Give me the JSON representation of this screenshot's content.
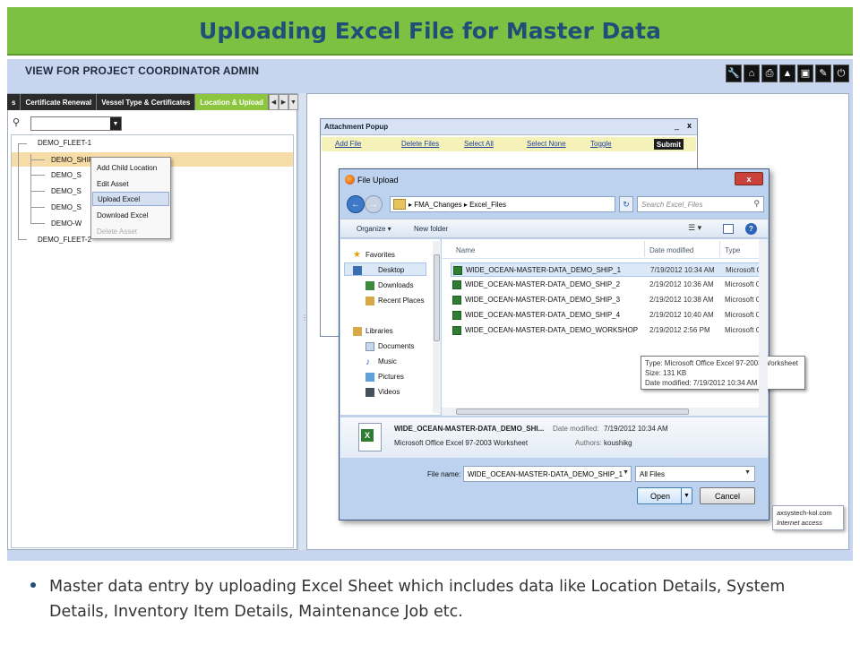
{
  "slide": {
    "title": "Uploading Excel File for Master Data",
    "bullet": "Master data entry by uploading Excel Sheet which includes data like Location Details, System Details, Inventory Item Details, Maintenance Job etc."
  },
  "app": {
    "view_title": "VIEW FOR PROJECT COORDINATOR ADMIN",
    "toolbar_icons": [
      "wrench-icon",
      "home-icon",
      "print-icon",
      "warning-icon",
      "document-icon",
      "pencil-icon",
      "power-icon"
    ],
    "tabs": [
      {
        "label": "s"
      },
      {
        "label": "Certificate Renewal"
      },
      {
        "label": "Vessel Type & Certificates"
      },
      {
        "label": "Location & Upload",
        "active": true
      }
    ],
    "tree": {
      "nodes": [
        "DEMO_FLEET-1",
        "DEMO_SHIP_1",
        "DEMO_S",
        "DEMO_S",
        "DEMO_S",
        "DEMO-W",
        "DEMO_FLEET-2"
      ]
    },
    "context_menu": {
      "items": [
        {
          "label": "Add Child Location"
        },
        {
          "label": "Edit Asset"
        },
        {
          "label": "Upload Excel",
          "hover": true
        },
        {
          "label": "Download Excel"
        },
        {
          "label": "Delete Asset",
          "disabled": true
        }
      ]
    },
    "attachment_popup": {
      "title": "Attachment Popup",
      "links": [
        "Add File",
        "Delete Files",
        "Select All",
        "Select None",
        "Toggle"
      ],
      "submit": "Submit",
      "minimize": "_",
      "close": "x"
    },
    "file_dialog": {
      "title": "File Upload",
      "close": "x",
      "path_parts": [
        "FMA_Changes",
        "Excel_Files"
      ],
      "path_separator": "▸",
      "search_placeholder": "Search Excel_Files",
      "organize": "Organize ▾",
      "new_folder": "New folder",
      "nav": {
        "favorites": "Favorites",
        "desktop": "Desktop",
        "downloads": "Downloads",
        "recent": "Recent Places",
        "libraries": "Libraries",
        "documents": "Documents",
        "music": "Music",
        "pictures": "Pictures",
        "videos": "Videos"
      },
      "columns": {
        "name": "Name",
        "date": "Date modified",
        "type": "Type"
      },
      "files": [
        {
          "name": "WIDE_OCEAN-MASTER-DATA_DEMO_SHIP_1",
          "date": "7/19/2012 10:34 AM",
          "type": "Microsoft O",
          "selected": true
        },
        {
          "name": "WIDE_OCEAN-MASTER-DATA_DEMO_SHIP_2",
          "date": "2/19/2012 10:36 AM",
          "type": "Microsoft O"
        },
        {
          "name": "WIDE_OCEAN-MASTER-DATA_DEMO_SHIP_3",
          "date": "2/19/2012 10:38 AM",
          "type": "Microsoft O"
        },
        {
          "name": "WIDE_OCEAN-MASTER-DATA_DEMO_SHIP_4",
          "date": "2/19/2012 10:40 AM",
          "type": "Microsoft O"
        },
        {
          "name": "WIDE_OCEAN-MASTER-DATA_DEMO_WORKSHOP",
          "date": "2/19/2012 2:56 PM",
          "type": "Microsoft O"
        }
      ],
      "tooltip": {
        "type": "Type: Microsoft Office Excel 97-2003 Worksheet",
        "size": "Size: 131 KB",
        "date": "Date modified: 7/19/2012 10:34 AM"
      },
      "details": {
        "name": "WIDE_OCEAN-MASTER-DATA_DEMO_SHI...",
        "date_label": "Date modified:",
        "date": "7/19/2012 10:34 AM",
        "type": "Microsoft Office Excel 97-2003 Worksheet",
        "authors_label": "Authors:",
        "authors": "koushikg"
      },
      "file_name_label": "File name:",
      "file_name_value": "WIDE_OCEAN-MASTER-DATA_DEMO_SHIP_1",
      "filter": "All Files",
      "open": "Open",
      "cancel": "Cancel"
    },
    "status": {
      "line1": "axsystech-kol.com",
      "line2": "Internet access"
    }
  }
}
